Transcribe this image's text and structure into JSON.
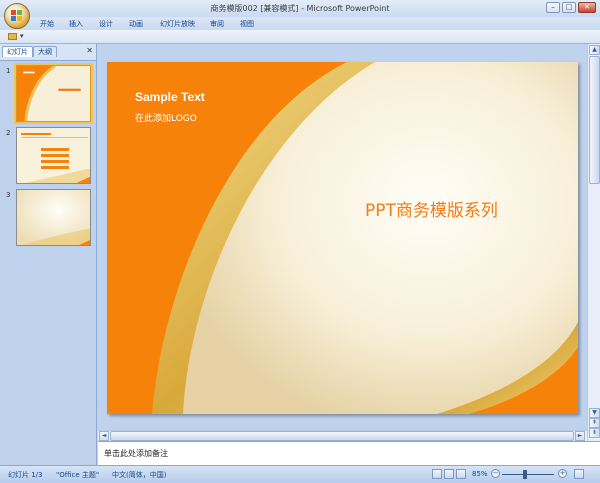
{
  "window": {
    "title": "商务模版002 [兼容模式] - Microsoft PowerPoint",
    "controls": {
      "minimize": "–",
      "maximize": "□",
      "close": "✕"
    }
  },
  "ribbon": {
    "tabs": [
      "开始",
      "插入",
      "设计",
      "动画",
      "幻灯片放映",
      "审阅",
      "视图"
    ]
  },
  "qat": {
    "customize_arrow": "▾"
  },
  "left_pane": {
    "tabs": {
      "slides": "幻灯片",
      "outline": "大纲"
    },
    "close_glyph": "✕",
    "slides": [
      {
        "number": "1",
        "selected": true
      },
      {
        "number": "2",
        "selected": false
      },
      {
        "number": "3",
        "selected": false
      }
    ]
  },
  "slide": {
    "title": "Sample Text",
    "subtitle": "在此添加LOGO",
    "main_text": "PPT商务模版系列",
    "colors": {
      "orange": "#f7820a",
      "cream": "#f7efd7",
      "gold": "#e9c25a",
      "title_orange": "#ef7d18"
    }
  },
  "scrollbars": {
    "up": "▲",
    "down": "▼",
    "left": "◄",
    "right": "►",
    "prev_slide": "⇞",
    "next_slide": "⇟"
  },
  "notes": {
    "placeholder": "单击此处添加备注"
  },
  "status_bar": {
    "slide_counter": "幻灯片 1/3",
    "theme": "\"Office 主题\"",
    "language": "中文(简体，中国)",
    "zoom": "85%",
    "zoom_minus": "−",
    "zoom_plus": "+"
  }
}
